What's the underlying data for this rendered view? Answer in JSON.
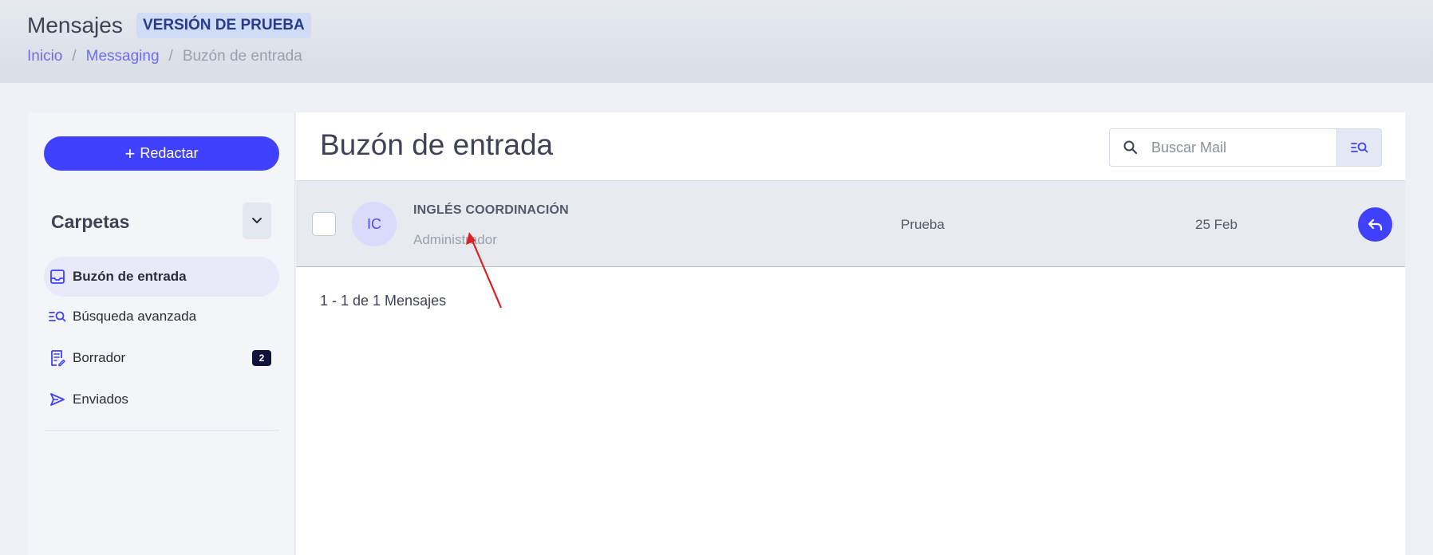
{
  "header": {
    "title": "Mensajes",
    "badge": "VERSIÓN DE PRUEBA",
    "breadcrumb": {
      "home": "Inicio",
      "section": "Messaging",
      "current": "Buzón de entrada",
      "separator": "/"
    }
  },
  "sidebar": {
    "compose_label": "Redactar",
    "folders_title": "Carpetas",
    "items": [
      {
        "label": "Buzón de entrada",
        "icon": "inbox-icon",
        "active": true
      },
      {
        "label": "Búsqueda avanzada",
        "icon": "advanced-search-icon"
      },
      {
        "label": "Borrador",
        "icon": "draft-icon",
        "badge": "2"
      },
      {
        "label": "Enviados",
        "icon": "send-icon"
      }
    ]
  },
  "main": {
    "title": "Buzón de entrada",
    "search_placeholder": "Buscar Mail",
    "messages": [
      {
        "avatar_initials": "IC",
        "sender": "INGLÉS COORDINACIÓN",
        "role": "Administrador",
        "subject": "Prueba",
        "date": "25 Feb"
      }
    ],
    "pagination": "1 - 1 de 1 Mensajes"
  },
  "colors": {
    "accent": "#4040ff",
    "badge_bg": "#cfdcf5",
    "row_bg": "#e7eaef",
    "annotation": "#e02020"
  }
}
